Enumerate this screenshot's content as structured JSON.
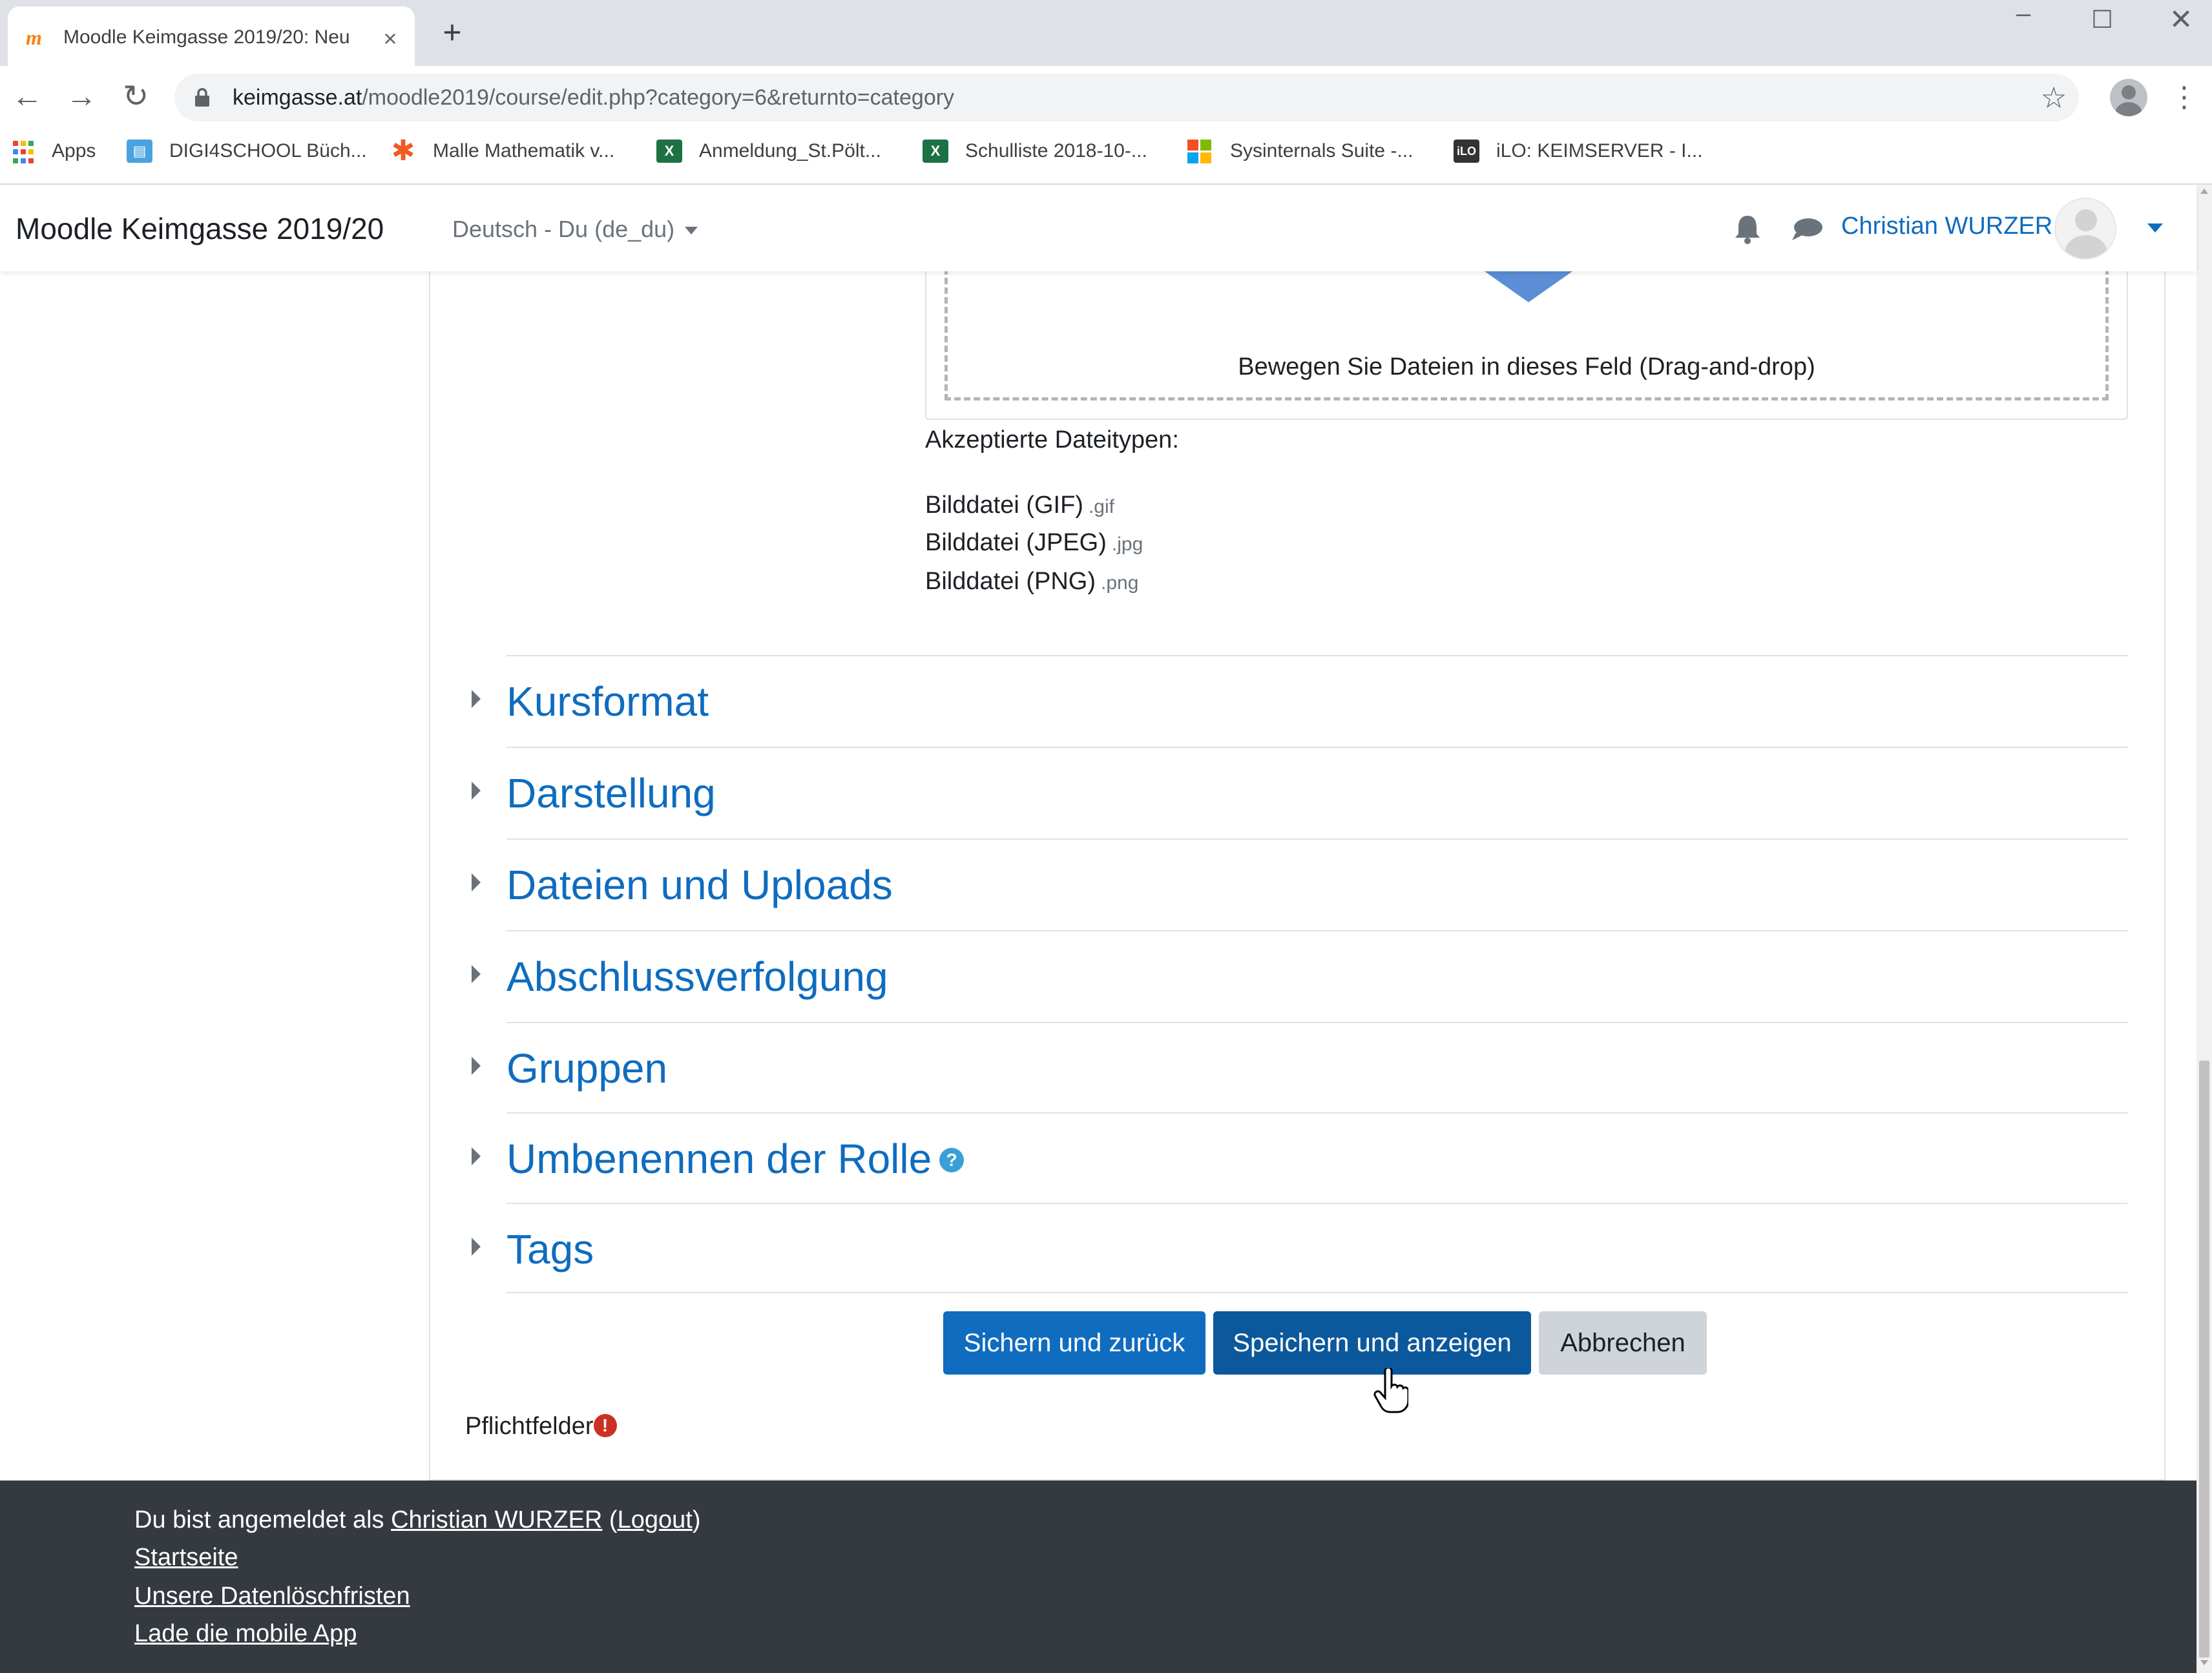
{
  "browser": {
    "tab_title": "Moodle Keimgasse 2019/20: Neu",
    "tab_close": "×",
    "new_tab": "+",
    "url_host": "keimgasse.at",
    "url_path": "/moodle2019/course/edit.php?category=6&returnto=category",
    "window_controls": {
      "minimize": "–",
      "maximize": "☐",
      "close": "✕"
    },
    "nav": {
      "back": "←",
      "forward": "→",
      "reload": "↻",
      "star": "☆",
      "menu": "⋮"
    },
    "bookmarks": [
      {
        "label": "Apps",
        "icon": "apps-grid-icon"
      },
      {
        "label": "DIGI4SCHOOL Büch...",
        "icon": "digi4school-icon",
        "color": "#4aa3df"
      },
      {
        "label": "Malle Mathematik v...",
        "icon": "asterisk-icon",
        "color": "#f05a22"
      },
      {
        "label": "Anmeldung_St.Pölt...",
        "icon": "excel-icon",
        "color": "#1e7145"
      },
      {
        "label": "Schulliste 2018-10-...",
        "icon": "excel-icon",
        "color": "#1e7145"
      },
      {
        "label": "Sysinternals Suite -...",
        "icon": "microsoft-icon"
      },
      {
        "label": "iLO: KEIMSERVER - I...",
        "icon": "ilo-icon",
        "color": "#333333"
      }
    ]
  },
  "navbar": {
    "site_name": "Moodle Keimgasse 2019/20",
    "language": "Deutsch - Du (de_du)",
    "user_name": "Christian WURZER"
  },
  "course_image": {
    "dropzone_text": "Bewegen Sie Dateien in dieses Feld (Drag-and-drop)",
    "accepted_label": "Akzeptierte Dateitypen:",
    "file_types": [
      {
        "label": "Bilddatei (GIF)",
        "ext": ".gif"
      },
      {
        "label": "Bilddatei (JPEG)",
        "ext": ".jpg"
      },
      {
        "label": "Bilddatei (PNG)",
        "ext": ".png"
      }
    ]
  },
  "sections": [
    {
      "title": "Kursformat"
    },
    {
      "title": "Darstellung"
    },
    {
      "title": "Dateien und Uploads"
    },
    {
      "title": "Abschlussverfolgung"
    },
    {
      "title": "Gruppen"
    },
    {
      "title": "Umbenennen der Rolle",
      "help_icon": "?"
    },
    {
      "title": "Tags"
    }
  ],
  "buttons": {
    "save_return": "Sichern und zurück",
    "save_display": "Speichern und anzeigen",
    "cancel": "Abbrechen"
  },
  "required": {
    "label": "Pflichtfelder",
    "icon": "!"
  },
  "footer": {
    "logged_in_prefix": "Du bist angemeldet als ",
    "user_link": "Christian WURZER",
    "logout_link": "Logout",
    "home_link": "Startseite",
    "data_retention_link": "Unsere Datenlöschfristen",
    "mobile_app_link": "Lade die mobile App"
  },
  "colors": {
    "brand": "#0f6cbf",
    "footer_bg": "#343a40",
    "required": "#ca3120",
    "help": "#3a9fd6"
  }
}
